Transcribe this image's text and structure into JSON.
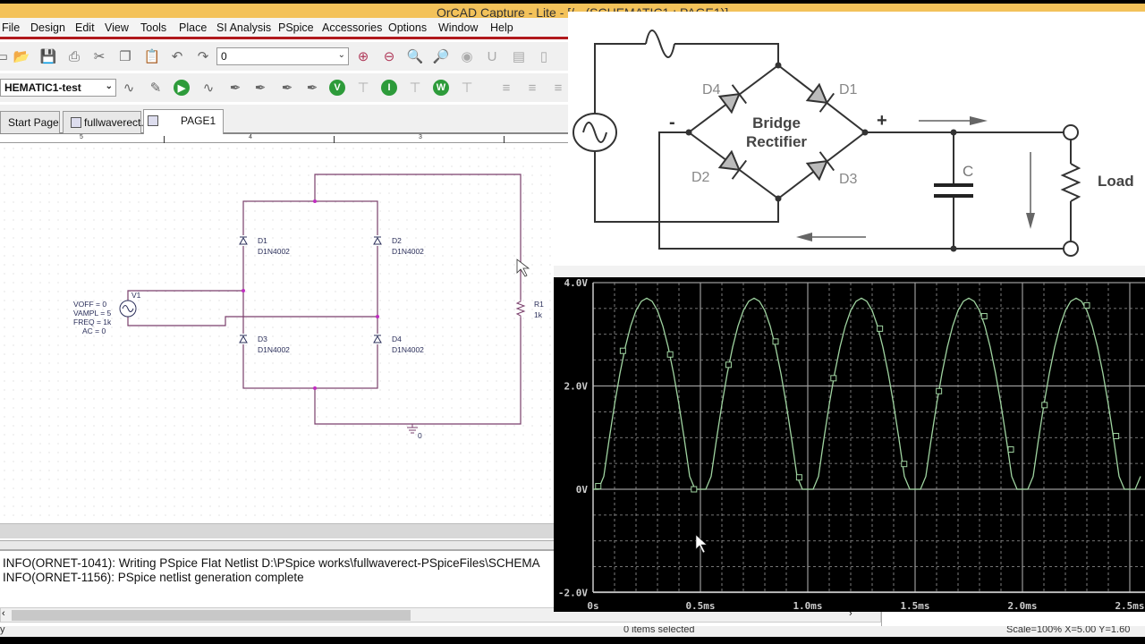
{
  "window": {
    "title": "OrCAD Capture - Lite - [/ - (SCHEMATIC1 : PAGE1)]"
  },
  "menu": [
    "File",
    "Design",
    "Edit",
    "View",
    "Tools",
    "Place",
    "SI Analysis",
    "PSpice",
    "Accessories",
    "Options",
    "Window",
    "Help"
  ],
  "toolbar1": {
    "icons": [
      "new-icon",
      "open-icon",
      "save-icon",
      "print-icon",
      "cut-icon",
      "copy-icon",
      "paste-icon",
      "undo-icon",
      "redo-icon"
    ],
    "part_combo_value": "0",
    "icons_right": [
      "zoom-in-icon",
      "zoom-out-icon",
      "zoom-area-icon",
      "zoom-all-icon",
      "show-icon",
      "annotate-icon",
      "drc-icon",
      "netlist-icon"
    ]
  },
  "toolbar2": {
    "profile_combo_value": "HEMATIC1-test",
    "icons": [
      "new-simulation-profile-icon",
      "edit-simulation-profile-icon",
      "run-pspice-icon",
      "view-simulation-results-icon",
      "voltage-marker-icon",
      "voltage-differential-marker-icon",
      "current-marker-icon",
      "power-marker-icon",
      "enable-bias-voltage-icon",
      "bias-voltage-toggle-icon",
      "enable-bias-current-icon",
      "bias-current-toggle-icon",
      "enable-bias-power-icon",
      "bias-power-toggle-icon",
      "align-left-icon",
      "align-center-icon",
      "align-right-icon"
    ],
    "green_letters": {
      "enable-bias-voltage-icon": "V",
      "enable-bias-current-icon": "I",
      "enable-bias-power-icon": "W"
    }
  },
  "tabs": [
    {
      "label": "Start Page"
    },
    {
      "label": "fullwaverect..."
    },
    {
      "label": "PAGE1",
      "active": true
    }
  ],
  "ruler": [
    "5",
    "4",
    "3"
  ],
  "schematic": {
    "source": {
      "ref": "V1",
      "params": [
        "VOFF = 0",
        "VAMPL = 5",
        "FREQ = 1k",
        "AC = 0"
      ]
    },
    "diodes": [
      {
        "ref": "D1",
        "model": "D1N4002"
      },
      {
        "ref": "D2",
        "model": "D1N4002"
      },
      {
        "ref": "D3",
        "model": "D1N4002"
      },
      {
        "ref": "D4",
        "model": "D1N4002"
      }
    ],
    "resistor": {
      "ref": "R1",
      "value": "1k"
    },
    "ground": "0",
    "colors": {
      "wire": "#7a3f6c",
      "junction": "#c02cbf",
      "text": "#2b2f5a"
    }
  },
  "log": [
    "INFO(ORNET-1041): Writing PSpice Flat Netlist D:\\PSpice works\\fullwaverect-PSpiceFiles\\SCHEMA",
    "INFO(ORNET-1156): PSpice netlist generation complete"
  ],
  "status": {
    "left": "y",
    "selection": "0 items selected",
    "coords": "Scale=100%    X=5.00  Y=1.60"
  },
  "reference_diagram": {
    "title": [
      "Bridge",
      "Rectifier"
    ],
    "diodes": [
      "D4",
      "D1",
      "D2",
      "D3"
    ],
    "plus": "+",
    "minus": "-",
    "capacitor": "C",
    "load": "Load"
  },
  "chart_data": {
    "type": "line",
    "title": "",
    "xlabel": "",
    "ylabel": "",
    "xlim": [
      0,
      2.57
    ],
    "ylim": [
      -2.0,
      4.0
    ],
    "x_unit": "ms",
    "x_ticks": [
      "0s",
      "0.5ms",
      "1.0ms",
      "1.5ms",
      "2.0ms",
      "2.5ms"
    ],
    "y_ticks": [
      "4.0V",
      "2.0V",
      "0V",
      "-2.0V"
    ],
    "y_tick_values": [
      4,
      2,
      0,
      -2
    ],
    "x_tick_values": [
      0,
      0.5,
      1.0,
      1.5,
      2.0,
      2.5
    ],
    "grid": true,
    "background": "#000000",
    "trace_color": "#9fd3a0",
    "grid_color": "#9a9a9a",
    "series": [
      {
        "x": [
          0,
          0.025,
          0.05,
          0.075,
          0.1,
          0.125,
          0.15,
          0.175,
          0.2,
          0.225,
          0.25,
          0.275,
          0.3,
          0.325,
          0.35,
          0.375,
          0.4,
          0.425,
          0.45,
          0.475,
          0.5,
          0.525,
          0.55,
          0.575,
          0.6,
          0.625,
          0.65,
          0.675,
          0.7,
          0.725,
          0.75,
          0.775,
          0.8,
          0.825,
          0.85,
          0.875,
          0.9,
          0.925,
          0.95,
          0.975,
          1.0,
          1.025,
          1.05,
          1.075,
          1.1,
          1.125,
          1.15,
          1.175,
          1.2,
          1.225,
          1.25,
          1.275,
          1.3,
          1.325,
          1.35,
          1.375,
          1.4,
          1.425,
          1.45,
          1.475,
          1.5,
          1.525,
          1.55,
          1.575,
          1.6,
          1.625,
          1.65,
          1.675,
          1.7,
          1.725,
          1.75,
          1.775,
          1.8,
          1.825,
          1.85,
          1.875,
          1.9,
          1.925,
          1.95,
          1.975,
          2.0,
          2.025,
          2.05,
          2.075,
          2.1,
          2.125,
          2.15,
          2.175,
          2.2,
          2.225,
          2.25,
          2.275,
          2.3,
          2.325,
          2.35,
          2.375,
          2.4,
          2.425,
          2.45,
          2.475,
          2.5,
          2.525,
          2.55
        ],
        "y": [
          0,
          0,
          0.25,
          0.97,
          1.64,
          2.24,
          2.75,
          3.16,
          3.46,
          3.64,
          3.7,
          3.64,
          3.46,
          3.16,
          2.75,
          2.24,
          1.64,
          0.97,
          0.25,
          0,
          0,
          0,
          0.25,
          0.97,
          1.64,
          2.24,
          2.75,
          3.16,
          3.46,
          3.64,
          3.7,
          3.64,
          3.46,
          3.16,
          2.75,
          2.24,
          1.64,
          0.97,
          0.25,
          0,
          0,
          0,
          0.25,
          0.97,
          1.64,
          2.24,
          2.75,
          3.16,
          3.46,
          3.64,
          3.7,
          3.64,
          3.46,
          3.16,
          2.75,
          2.24,
          1.64,
          0.97,
          0.25,
          0,
          0,
          0,
          0.25,
          0.97,
          1.64,
          2.24,
          2.75,
          3.16,
          3.46,
          3.64,
          3.7,
          3.64,
          3.46,
          3.16,
          2.75,
          2.24,
          1.64,
          0.97,
          0.25,
          0,
          0,
          0,
          0.25,
          0.97,
          1.64,
          2.24,
          2.75,
          3.16,
          3.46,
          3.64,
          3.7,
          3.64,
          3.46,
          3.16,
          2.75,
          2.24,
          1.64,
          0.97,
          0.25,
          0,
          0,
          0,
          0.25
        ]
      }
    ],
    "markers": [
      [
        0.024,
        0.06
      ],
      [
        0.139,
        2.68
      ],
      [
        0.359,
        2.61
      ],
      [
        0.47,
        0
      ],
      [
        0.631,
        2.41
      ],
      [
        0.85,
        2.86
      ],
      [
        0.96,
        0.23
      ],
      [
        1.12,
        2.15
      ],
      [
        1.336,
        3.11
      ],
      [
        1.449,
        0.49
      ],
      [
        1.611,
        1.9
      ],
      [
        1.822,
        3.35
      ],
      [
        1.946,
        0.77
      ],
      [
        2.103,
        1.63
      ],
      [
        2.3,
        3.56
      ],
      [
        2.436,
        1.03
      ]
    ]
  }
}
